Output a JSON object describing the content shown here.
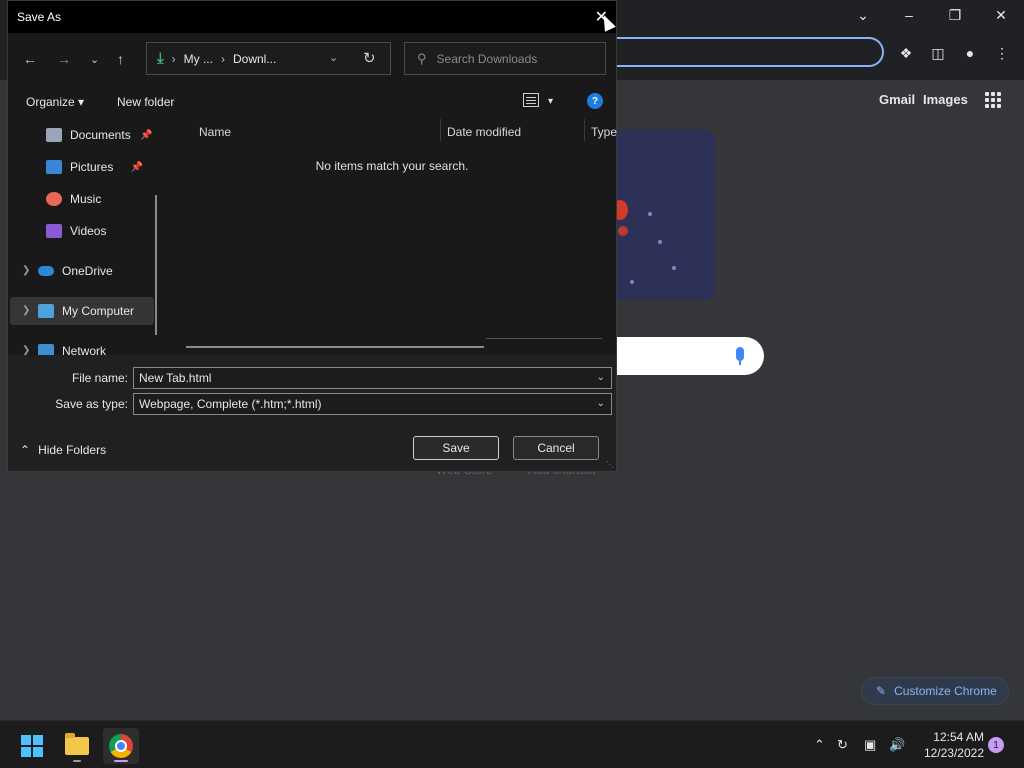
{
  "chrome": {
    "links": {
      "gmail": "Gmail",
      "images": "Images"
    },
    "customize_label": "Customize Chrome",
    "ghost_text_1": "Web Store",
    "ghost_text_2": "Add shortcut"
  },
  "dialog": {
    "title": "Save As",
    "breadcrumb": [
      "My ...",
      "Downl..."
    ],
    "search_placeholder": "Search Downloads",
    "commands": {
      "organize": "Organize",
      "new_folder": "New folder"
    },
    "nav_items": [
      {
        "label": "Documents",
        "icon": "documents-icon",
        "pinned": true
      },
      {
        "label": "Pictures",
        "icon": "pictures-icon",
        "pinned": true
      },
      {
        "label": "Music",
        "icon": "music-icon",
        "pinned": false
      },
      {
        "label": "Videos",
        "icon": "videos-icon",
        "pinned": false
      },
      {
        "label": "OneDrive",
        "icon": "onedrive-icon",
        "pinned": false
      },
      {
        "label": "My Computer",
        "icon": "computer-icon",
        "pinned": false,
        "selected": true
      },
      {
        "label": "Network",
        "icon": "network-icon",
        "pinned": false
      }
    ],
    "columns": [
      "Name",
      "Date modified",
      "Type"
    ],
    "empty_message": "No items match your search.",
    "file_name_label": "File name:",
    "file_name_value": "New Tab.html",
    "save_type_label": "Save as type:",
    "save_type_value": "Webpage, Complete (*.htm;*.html)",
    "hide_folders": "Hide Folders",
    "save_button": "Save",
    "cancel_button": "Cancel"
  },
  "taskbar": {
    "time": "12:54 AM",
    "date": "12/23/2022",
    "notification_count": "1"
  },
  "colors": {
    "accent": "#8ab4f8",
    "help": "#1f7de0",
    "download": "#3cb371"
  }
}
